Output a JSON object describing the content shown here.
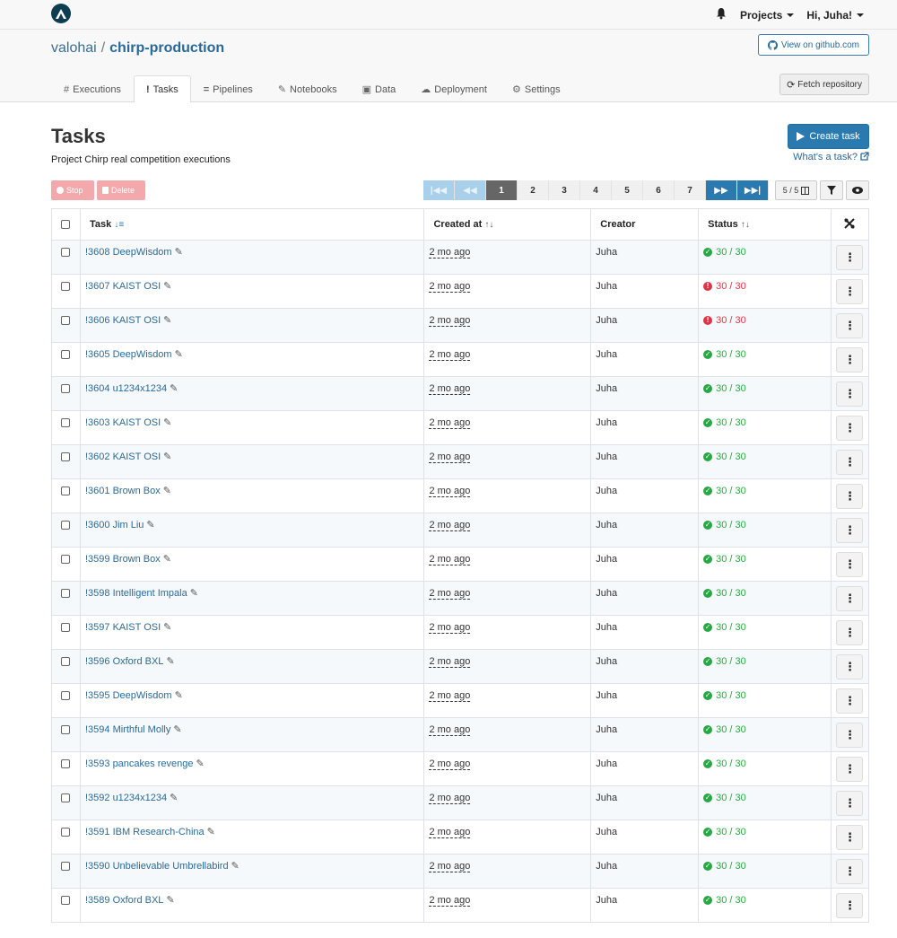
{
  "nav": {
    "projects": "Projects",
    "user": "Hi, Juha!"
  },
  "breadcrumb": {
    "owner": "valohai",
    "separator": "/",
    "project": "chirp-production"
  },
  "header": {
    "github_label": "View on github.com",
    "fetch_label": "Fetch repository"
  },
  "tabs": [
    {
      "icon": "#",
      "label": "Executions"
    },
    {
      "icon": "!",
      "label": "Tasks"
    },
    {
      "icon": "=",
      "label": "Pipelines"
    },
    {
      "icon": "✎",
      "label": "Notebooks"
    },
    {
      "icon": "▣",
      "label": "Data"
    },
    {
      "icon": "☁",
      "label": "Deployment"
    },
    {
      "icon": "⚙",
      "label": "Settings"
    }
  ],
  "page": {
    "title": "Tasks",
    "subtitle": "Project Chirp real competition executions",
    "create_label": "Create task",
    "help_label": "What's a task?"
  },
  "actions": {
    "stop": "Stop",
    "delete": "Delete"
  },
  "pager": {
    "pages": [
      "1",
      "2",
      "3",
      "4",
      "5",
      "6",
      "7"
    ],
    "current": "1",
    "columns": "5 / 5"
  },
  "table": {
    "headers": {
      "task": "Task",
      "created": "Created at",
      "creator": "Creator",
      "status": "Status"
    },
    "rows": [
      {
        "task": "!3608 DeepWisdom",
        "created": "2 mo ago",
        "creator": "Juha",
        "status": "30 / 30",
        "state": "ok"
      },
      {
        "task": "!3607 KAIST OSI",
        "created": "2 mo ago",
        "creator": "Juha",
        "status": "30 / 30",
        "state": "err"
      },
      {
        "task": "!3606 KAIST OSI",
        "created": "2 mo ago",
        "creator": "Juha",
        "status": "30 / 30",
        "state": "err"
      },
      {
        "task": "!3605 DeepWisdom",
        "created": "2 mo ago",
        "creator": "Juha",
        "status": "30 / 30",
        "state": "ok"
      },
      {
        "task": "!3604 u1234x1234",
        "created": "2 mo ago",
        "creator": "Juha",
        "status": "30 / 30",
        "state": "ok"
      },
      {
        "task": "!3603 KAIST OSI",
        "created": "2 mo ago",
        "creator": "Juha",
        "status": "30 / 30",
        "state": "ok"
      },
      {
        "task": "!3602 KAIST OSI",
        "created": "2 mo ago",
        "creator": "Juha",
        "status": "30 / 30",
        "state": "ok"
      },
      {
        "task": "!3601 Brown Box",
        "created": "2 mo ago",
        "creator": "Juha",
        "status": "30 / 30",
        "state": "ok"
      },
      {
        "task": "!3600 Jim Liu",
        "created": "2 mo ago",
        "creator": "Juha",
        "status": "30 / 30",
        "state": "ok"
      },
      {
        "task": "!3599 Brown Box",
        "created": "2 mo ago",
        "creator": "Juha",
        "status": "30 / 30",
        "state": "ok"
      },
      {
        "task": "!3598 Intelligent Impala",
        "created": "2 mo ago",
        "creator": "Juha",
        "status": "30 / 30",
        "state": "ok"
      },
      {
        "task": "!3597 KAIST OSI",
        "created": "2 mo ago",
        "creator": "Juha",
        "status": "30 / 30",
        "state": "ok"
      },
      {
        "task": "!3596 Oxford BXL",
        "created": "2 mo ago",
        "creator": "Juha",
        "status": "30 / 30",
        "state": "ok"
      },
      {
        "task": "!3595 DeepWisdom",
        "created": "2 mo ago",
        "creator": "Juha",
        "status": "30 / 30",
        "state": "ok"
      },
      {
        "task": "!3594 Mirthful Molly",
        "created": "2 mo ago",
        "creator": "Juha",
        "status": "30 / 30",
        "state": "ok"
      },
      {
        "task": "!3593 pancakes revenge",
        "created": "2 mo ago",
        "creator": "Juha",
        "status": "30 / 30",
        "state": "ok"
      },
      {
        "task": "!3592 u1234x1234",
        "created": "2 mo ago",
        "creator": "Juha",
        "status": "30 / 30",
        "state": "ok"
      },
      {
        "task": "!3591 IBM Research-China",
        "created": "2 mo ago",
        "creator": "Juha",
        "status": "30 / 30",
        "state": "ok"
      },
      {
        "task": "!3590 Unbelievable Umbrellabird",
        "created": "2 mo ago",
        "creator": "Juha",
        "status": "30 / 30",
        "state": "ok"
      },
      {
        "task": "!3589 Oxford BXL",
        "created": "2 mo ago",
        "creator": "Juha",
        "status": "30 / 30",
        "state": "ok"
      }
    ]
  },
  "colors": {
    "accent": "#2a7ab0",
    "success": "#28a745",
    "error": "#dc3545",
    "link": "#2a6a98"
  }
}
